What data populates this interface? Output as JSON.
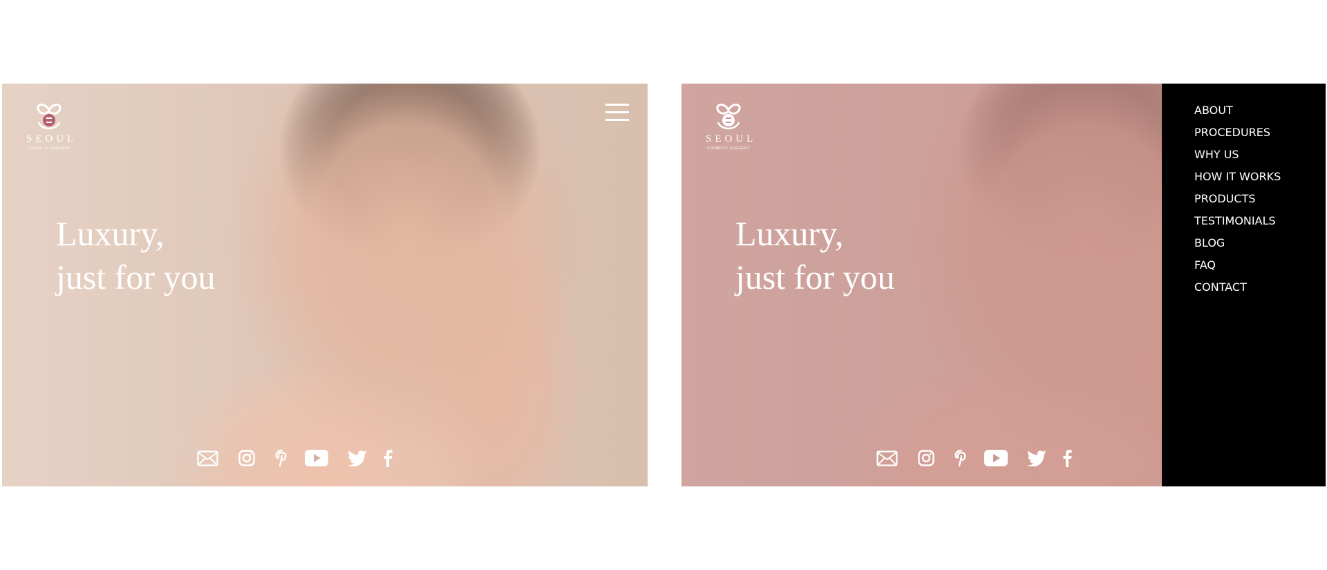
{
  "brand": {
    "name": "SEOUL",
    "tagline": "COSMETIC SURGERY",
    "accent_color": "#b2606e"
  },
  "hero": {
    "headline_line1": "Luxury,",
    "headline_line2": "just for you"
  },
  "social_icons": [
    "mail-icon",
    "instagram-icon",
    "pinterest-icon",
    "youtube-icon",
    "twitter-icon",
    "facebook-icon"
  ],
  "menu": {
    "items": [
      "ABOUT",
      "PROCEDURES",
      "WHY US",
      "HOW IT WORKS",
      "PRODUCTS",
      "TESTIMONIALS",
      "BLOG",
      "FAQ",
      "CONTACT"
    ]
  },
  "colors": {
    "overlay_tint": "#be8080",
    "menu_background": "#000000",
    "text": "#ffffff"
  }
}
